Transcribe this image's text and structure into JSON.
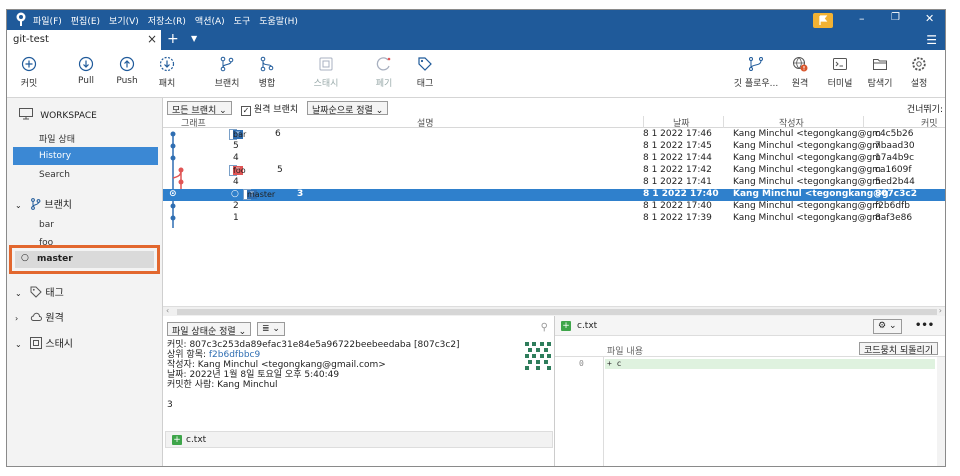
{
  "window": {
    "menu": [
      "파일(F)",
      "편집(E)",
      "보기(V)",
      "저장소(R)",
      "액션(A)",
      "도구",
      "도움말(H)"
    ],
    "tab_title": "git-test"
  },
  "toolbar": {
    "left": [
      {
        "label": "커밋",
        "icon": "plus-circle-icon"
      },
      {
        "label": "Pull",
        "icon": "arrow-down-circle-icon"
      },
      {
        "label": "Push",
        "icon": "arrow-up-circle-icon"
      },
      {
        "label": "패치",
        "icon": "fetch-icon"
      },
      {
        "label": "브랜치",
        "icon": "branch-icon"
      },
      {
        "label": "병합",
        "icon": "merge-icon"
      },
      {
        "label": "스태시",
        "icon": "stash-icon"
      },
      {
        "label": "폐기",
        "icon": "discard-icon"
      },
      {
        "label": "태그",
        "icon": "tag-icon"
      }
    ],
    "right": [
      {
        "label": "깃 플로우...",
        "icon": "git-flow-icon"
      },
      {
        "label": "원격",
        "icon": "remote-icon"
      },
      {
        "label": "터미널",
        "icon": "terminal-icon"
      },
      {
        "label": "탐색기",
        "icon": "explorer-icon"
      },
      {
        "label": "설정",
        "icon": "settings-icon"
      }
    ]
  },
  "sidebar": {
    "workspace": "WORKSPACE",
    "workspace_items": [
      "파일 상태",
      "History",
      "Search"
    ],
    "branches_label": "브랜치",
    "branches": [
      "bar",
      "foo",
      "master"
    ],
    "tags_label": "태그",
    "remotes_label": "원격",
    "stash_label": "스태시"
  },
  "filters": {
    "branches": "모든 브랜치",
    "remote_branches": "원격 브랜치",
    "sort": "날짜순으로 정렬",
    "jump": "건너뛰기:"
  },
  "columns": {
    "graph": "그래프",
    "desc": "설명",
    "date": "날짜",
    "author": "작성자",
    "commit": "커밋"
  },
  "commits": [
    {
      "branch": "bar",
      "desc": "6",
      "date": "8 1 2022 17:46",
      "author": "Kang Minchul <tegongkang@gm",
      "hash": "c4c5b26"
    },
    {
      "branch": "",
      "desc": "5",
      "date": "8 1 2022 17:45",
      "author": "Kang Minchul <tegongkang@gm",
      "hash": "7baad30"
    },
    {
      "branch": "",
      "desc": "4",
      "date": "8 1 2022 17:44",
      "author": "Kang Minchul <tegongkang@gm",
      "hash": "17a4b9c"
    },
    {
      "branch": "foo",
      "desc": "5",
      "date": "8 1 2022 17:42",
      "author": "Kang Minchul <tegongkang@gm",
      "hash": "ca1609f"
    },
    {
      "branch": "",
      "desc": "4",
      "date": "8 1 2022 17:41",
      "author": "Kang Minchul <tegongkang@gm",
      "hash": "5ed2b44"
    },
    {
      "branch": "master",
      "desc": "3",
      "date": "8 1 2022 17:40",
      "author": "Kang Minchul <tegongkang@g",
      "hash": "807c3c2"
    },
    {
      "branch": "",
      "desc": "2",
      "date": "8 1 2022 17:40",
      "author": "Kang Minchul <tegongkang@gm",
      "hash": "f2b6dfb"
    },
    {
      "branch": "",
      "desc": "1",
      "date": "8 1 2022 17:39",
      "author": "Kang Minchul <tegongkang@gm",
      "hash": "8af3e86"
    }
  ],
  "details": {
    "sort": "파일 상태순 정렬",
    "commit_line": "커밋: 807c3c253da89efac31e84e5a96722beebeedaba [807c3c2]",
    "parent_label": "상위 항목:",
    "parent_hash": "f2b6dfbbc9",
    "author_line": "작성자: Kang Minchul <tegongkang@gmail.com>",
    "date_line": "날짜: 2022년 1월 8일 토요일 오후 5:40:49",
    "committer_line": "커밋한 사람: Kang Minchul",
    "message": "3",
    "file": "c.txt"
  },
  "diff": {
    "file": "c.txt",
    "content_label": "파일 내용",
    "revert_button": "코드뭉치 되돌리기",
    "line_no": "0",
    "line": "+ c"
  }
}
